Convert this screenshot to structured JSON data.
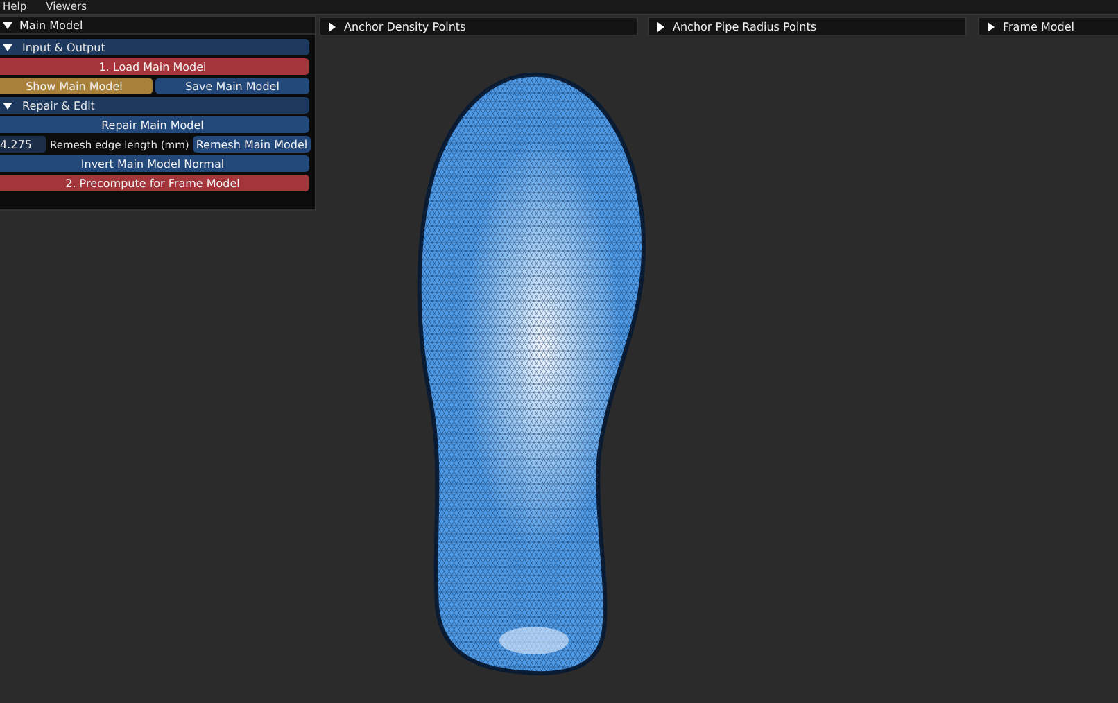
{
  "menu": [
    "Help",
    "Viewers"
  ],
  "main_panel": {
    "title": "Main Model",
    "expanded": true,
    "sections": [
      {
        "title": "Input & Output",
        "expanded": true,
        "rows": [
          [
            {
              "kind": "accent",
              "label": "1. Load Main Model"
            }
          ],
          [
            {
              "kind": "active",
              "label": "Show Main Model"
            },
            {
              "kind": "normal",
              "label": "Save Main Model"
            }
          ]
        ]
      },
      {
        "title": "Repair & Edit",
        "expanded": true,
        "rows": [
          [
            {
              "kind": "normal",
              "label": "Repair Main Model"
            }
          ],
          [
            {
              "kind": "field",
              "value": "4.275",
              "label": "Remesh edge length (mm)"
            },
            {
              "kind": "normal",
              "label": "Remesh Main Model"
            }
          ],
          [
            {
              "kind": "normal",
              "label": "Invert Main Model Normal"
            }
          ],
          [
            {
              "kind": "accent",
              "label": "2. Precompute for Frame Model"
            }
          ]
        ]
      }
    ]
  },
  "collapsed_panels": [
    {
      "title": "Anchor Density Points",
      "expanded": false
    },
    {
      "title": "Anchor Pipe Radius Points",
      "expanded": false
    },
    {
      "title": "Frame Model",
      "expanded": false
    }
  ]
}
